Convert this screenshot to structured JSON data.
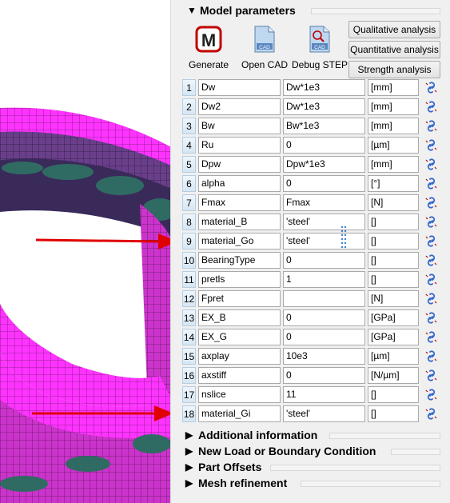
{
  "colors": {
    "accent": "#c00000",
    "mesh_magenta": "#ff33ff",
    "mesh_dark": "#3a3a6a",
    "mesh_teal": "#2f6b63",
    "arrow": "#e00000",
    "link_icon": "#3366cc"
  },
  "model_parameters": {
    "title": "Model parameters",
    "toolbar": {
      "generate_label": "Generate",
      "open_cad_label": "Open CAD",
      "debug_step_label": "Debug STEP",
      "cad_icon_text": "CAD"
    },
    "analysis_buttons": [
      {
        "label": "Qualitative analysis"
      },
      {
        "label": "Quantitative analysis"
      },
      {
        "label": "Strength analysis"
      }
    ],
    "rows": [
      {
        "index": "1",
        "name": "Dw",
        "value": "Dw*1e3",
        "unit": "[mm]"
      },
      {
        "index": "2",
        "name": "Dw2",
        "value": "Dw*1e3",
        "unit": "[mm]"
      },
      {
        "index": "3",
        "name": "Bw",
        "value": "Bw*1e3",
        "unit": "[mm]"
      },
      {
        "index": "4",
        "name": "Ru",
        "value": "0",
        "unit": "[µm]"
      },
      {
        "index": "5",
        "name": "Dpw",
        "value": "Dpw*1e3",
        "unit": "[mm]"
      },
      {
        "index": "6",
        "name": "alpha",
        "value": "0",
        "unit": "[°]"
      },
      {
        "index": "7",
        "name": "Fmax",
        "value": "Fmax",
        "unit": "[N]"
      },
      {
        "index": "8",
        "name": "material_B",
        "value": "'steel'",
        "unit": "[]"
      },
      {
        "index": "9",
        "name": "material_Go",
        "value": "'steel'",
        "unit": "[]"
      },
      {
        "index": "10",
        "name": "BearingType",
        "value": "0",
        "unit": "[]"
      },
      {
        "index": "11",
        "name": "pretls",
        "value": "1",
        "unit": "[]"
      },
      {
        "index": "12",
        "name": "Fpret",
        "value": "",
        "unit": "[N]"
      },
      {
        "index": "13",
        "name": "EX_B",
        "value": "0",
        "unit": "[GPa]"
      },
      {
        "index": "14",
        "name": "EX_G",
        "value": "0",
        "unit": "[GPa]"
      },
      {
        "index": "15",
        "name": "axplay",
        "value": "10e3",
        "unit": "[µm]"
      },
      {
        "index": "16",
        "name": "axstiff",
        "value": "0",
        "unit": "[N/µm]"
      },
      {
        "index": "17",
        "name": "nslice",
        "value": "11",
        "unit": "[]"
      },
      {
        "index": "18",
        "name": "material_Gi",
        "value": "'steel'",
        "unit": "[]"
      }
    ]
  },
  "collapsed_sections": [
    {
      "title": "Additional information"
    },
    {
      "title": "New Load or Boundary Condition"
    },
    {
      "title": "Part Offsets"
    },
    {
      "title": "Mesh refinement"
    }
  ]
}
